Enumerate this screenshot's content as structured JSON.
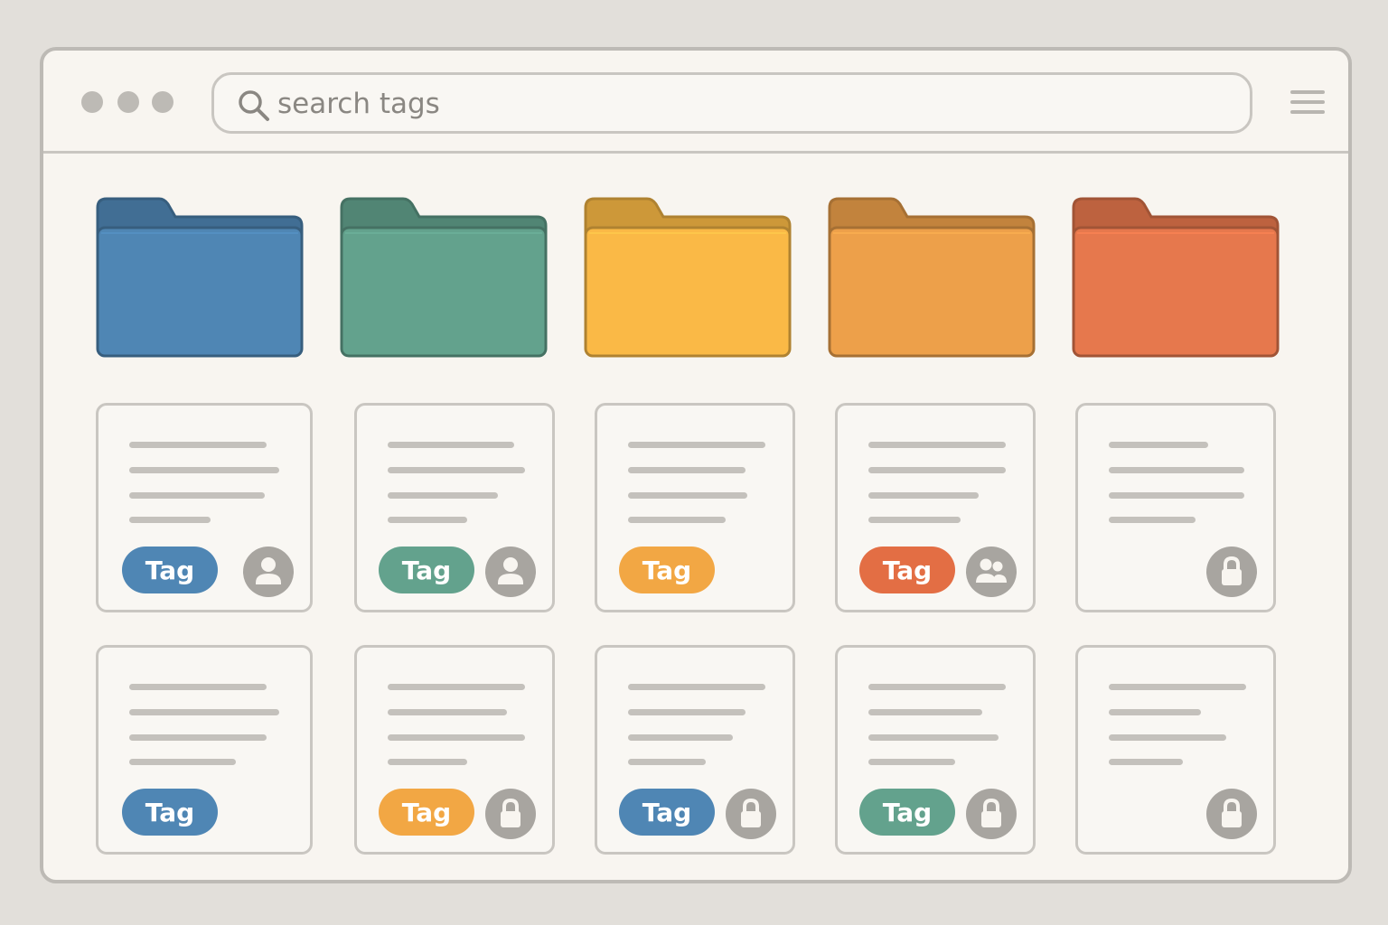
{
  "search": {
    "placeholder": "search tags"
  },
  "colors": {
    "blue": "#4f86b4",
    "green": "#63a28d",
    "yellow": "#fab946",
    "orange": "#eda04a",
    "red": "#e6784d",
    "tag_blue": "#4f86b4",
    "tag_green": "#63a28d",
    "tag_amber": "#f2a744",
    "tag_red": "#e36e44"
  },
  "folders": [
    {
      "icon": "folder-icon",
      "color": "blue"
    },
    {
      "icon": "folder-icon",
      "color": "green"
    },
    {
      "icon": "folder-icon",
      "color": "yellow"
    },
    {
      "icon": "folder-icon",
      "color": "orange"
    },
    {
      "icon": "folder-icon",
      "color": "red"
    }
  ],
  "cards": [
    {
      "tag": "Tag",
      "tag_color": "tag_blue",
      "icon": "user-icon"
    },
    {
      "tag": "Tag",
      "tag_color": "tag_green",
      "icon": "user-icon"
    },
    {
      "tag": "Tag",
      "tag_color": "tag_amber",
      "icon": ""
    },
    {
      "tag": "Tag",
      "tag_color": "tag_red",
      "icon": "group-icon"
    },
    {
      "tag": "",
      "tag_color": "",
      "icon": "lock-icon"
    },
    {
      "tag": "Tag",
      "tag_color": "tag_blue",
      "icon": ""
    },
    {
      "tag": "Tag",
      "tag_color": "tag_amber",
      "icon": "lock-icon"
    },
    {
      "tag": "Tag",
      "tag_color": "tag_blue",
      "icon": "lock-icon"
    },
    {
      "tag": "Tag",
      "tag_color": "tag_green",
      "icon": "lock-icon"
    },
    {
      "tag": "",
      "tag_color": "",
      "icon": "lock-icon"
    }
  ]
}
